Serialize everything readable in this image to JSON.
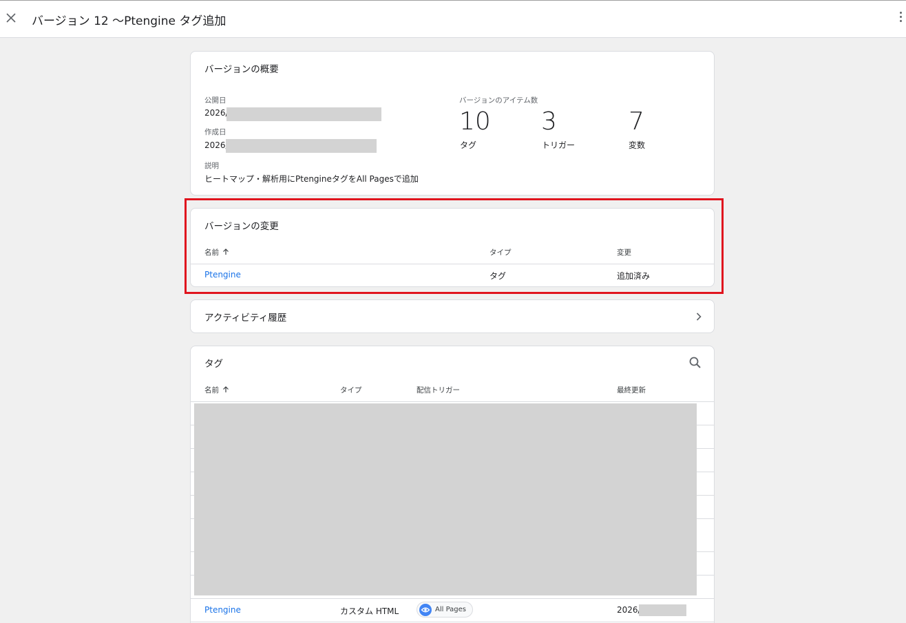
{
  "header": {
    "title": "バージョン 12 〜Ptengine タグ追加"
  },
  "summary": {
    "title": "バージョンの概要",
    "published_label": "公開日",
    "published_value": "2026/",
    "created_label": "作成日",
    "created_value": "2026/",
    "description_label": "説明",
    "description_value": "ヒートマップ・解析用にPtengineタグをAll Pagesで追加",
    "items_label": "バージョンのアイテム数",
    "counts": [
      {
        "value": "10",
        "label": "タグ"
      },
      {
        "value": "3",
        "label": "トリガー"
      },
      {
        "value": "7",
        "label": "変数"
      }
    ]
  },
  "changes": {
    "title": "バージョンの変更",
    "columns": {
      "name": "名前",
      "type": "タイプ",
      "change": "変更"
    },
    "rows": [
      {
        "name": "Ptengine",
        "type": "タグ",
        "change": "追加済み"
      }
    ]
  },
  "activity": {
    "label": "アクティビティ履歴"
  },
  "tags": {
    "title": "タグ",
    "columns": {
      "name": "名前",
      "type": "タイプ",
      "trigger": "配信トリガー",
      "updated": "最終更新"
    },
    "visible_row": {
      "name": "Ptengine",
      "type": "カスタム HTML",
      "trigger": "All Pages",
      "updated": "2026/"
    }
  },
  "colors": {
    "link": "#1a73e8",
    "highlight": "#e0141e",
    "trigger_icon": "#4285f4",
    "redaction": "#d3d3d3"
  },
  "icons": [
    "close-icon",
    "more-vert-icon",
    "sort-arrow-up-icon",
    "chevron-right-icon",
    "search-icon",
    "eye-icon"
  ]
}
